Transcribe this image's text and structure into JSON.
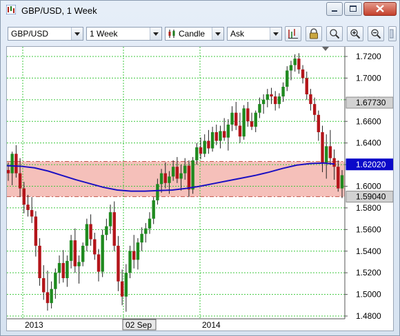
{
  "window": {
    "title": "GBP/USD,  1 Week",
    "minimize_glyph": "minimize-icon",
    "maximize_glyph": "maximize-icon",
    "close_glyph": "close-icon"
  },
  "toolbar": {
    "symbol": "GBP/USD",
    "timeframe": "1 Week",
    "chart_type": "Candle",
    "price_side": "Ask",
    "buttons": [
      "bar-chart-icon",
      "lock-icon",
      "zoom-fit-icon",
      "zoom-in-icon",
      "zoom-out-icon",
      "scroll-icon"
    ]
  },
  "chart_data": {
    "type": "candlestick",
    "symbol": "GBP/USD",
    "timeframe": "1 Week",
    "ylim": [
      1.47,
      1.728
    ],
    "y_ticks": [
      "1.7200",
      "1.7000",
      "1.6800",
      "1.6600",
      "1.6400",
      "1.6200",
      "1.6000",
      "1.5800",
      "1.5600",
      "1.5400",
      "1.5200",
      "1.5000",
      "1.4800"
    ],
    "x_labels": [
      "2013",
      "02 Sep",
      "2014"
    ],
    "price_labels": [
      {
        "value": "1.67730",
        "style": "gray"
      },
      {
        "value": "1.62020",
        "style": "blue"
      },
      {
        "value": "1.59040",
        "style": "gray"
      }
    ],
    "band": {
      "upper": 1.6229,
      "lower": 1.5904,
      "color": "#f4b9b3"
    },
    "moving_average": {
      "color": "#1b0fc2",
      "points": [
        [
          0,
          1.619
        ],
        [
          20,
          1.6185
        ],
        [
          40,
          1.617
        ],
        [
          60,
          1.614
        ],
        [
          80,
          1.61
        ],
        [
          100,
          1.606
        ],
        [
          120,
          1.6025
        ],
        [
          140,
          1.599
        ],
        [
          160,
          1.5965
        ],
        [
          180,
          1.5955
        ],
        [
          200,
          1.5955
        ],
        [
          220,
          1.596
        ],
        [
          240,
          1.5965
        ],
        [
          260,
          1.598
        ],
        [
          280,
          1.6
        ],
        [
          300,
          1.6025
        ],
        [
          320,
          1.605
        ],
        [
          340,
          1.6075
        ],
        [
          360,
          1.61
        ],
        [
          380,
          1.613
        ],
        [
          400,
          1.6165
        ],
        [
          420,
          1.6195
        ],
        [
          440,
          1.621
        ],
        [
          460,
          1.6215
        ],
        [
          475,
          1.6205
        ]
      ]
    },
    "candles": [
      [
        1.615,
        1.622,
        1.605,
        1.612
      ],
      [
        1.612,
        1.632,
        1.601,
        1.63
      ],
      [
        1.63,
        1.638,
        1.608,
        1.612
      ],
      [
        1.612,
        1.626,
        1.59,
        1.598
      ],
      [
        1.598,
        1.604,
        1.575,
        1.583
      ],
      [
        1.583,
        1.592,
        1.572,
        1.578
      ],
      [
        1.578,
        1.59,
        1.566,
        1.572
      ],
      [
        1.572,
        1.577,
        1.535,
        1.545
      ],
      [
        1.545,
        1.552,
        1.508,
        1.515
      ],
      [
        1.515,
        1.527,
        1.495,
        1.502
      ],
      [
        1.502,
        1.522,
        1.485,
        1.492
      ],
      [
        1.492,
        1.512,
        1.487,
        1.505
      ],
      [
        1.505,
        1.524,
        1.496,
        1.52
      ],
      [
        1.52,
        1.536,
        1.51,
        1.529
      ],
      [
        1.529,
        1.541,
        1.511,
        1.515
      ],
      [
        1.515,
        1.536,
        1.507,
        1.531
      ],
      [
        1.531,
        1.555,
        1.524,
        1.55
      ],
      [
        1.55,
        1.561,
        1.52,
        1.526
      ],
      [
        1.526,
        1.536,
        1.51,
        1.53
      ],
      [
        1.53,
        1.548,
        1.526,
        1.545
      ],
      [
        1.545,
        1.57,
        1.54,
        1.565
      ],
      [
        1.565,
        1.574,
        1.545,
        1.551
      ],
      [
        1.551,
        1.557,
        1.532,
        1.537
      ],
      [
        1.537,
        1.542,
        1.512,
        1.521
      ],
      [
        1.521,
        1.56,
        1.516,
        1.555
      ],
      [
        1.555,
        1.57,
        1.55,
        1.563
      ],
      [
        1.563,
        1.583,
        1.556,
        1.576
      ],
      [
        1.576,
        1.586,
        1.54,
        1.545
      ],
      [
        1.545,
        1.554,
        1.503,
        1.512
      ],
      [
        1.512,
        1.523,
        1.49,
        1.498
      ],
      [
        1.498,
        1.528,
        1.484,
        1.52
      ],
      [
        1.52,
        1.545,
        1.515,
        1.54
      ],
      [
        1.54,
        1.555,
        1.524,
        1.532
      ],
      [
        1.532,
        1.552,
        1.523,
        1.548
      ],
      [
        1.548,
        1.562,
        1.54,
        1.556
      ],
      [
        1.556,
        1.566,
        1.548,
        1.561
      ],
      [
        1.561,
        1.576,
        1.556,
        1.57
      ],
      [
        1.57,
        1.59,
        1.565,
        1.587
      ],
      [
        1.587,
        1.607,
        1.583,
        1.602
      ],
      [
        1.602,
        1.616,
        1.594,
        1.612
      ],
      [
        1.612,
        1.622,
        1.598,
        1.603
      ],
      [
        1.603,
        1.614,
        1.593,
        1.609
      ],
      [
        1.609,
        1.624,
        1.605,
        1.618
      ],
      [
        1.618,
        1.627,
        1.603,
        1.607
      ],
      [
        1.607,
        1.62,
        1.596,
        1.612
      ],
      [
        1.612,
        1.626,
        1.606,
        1.619
      ],
      [
        1.619,
        1.624,
        1.59,
        1.597
      ],
      [
        1.597,
        1.627,
        1.593,
        1.624
      ],
      [
        1.624,
        1.64,
        1.62,
        1.636
      ],
      [
        1.636,
        1.645,
        1.625,
        1.63
      ],
      [
        1.63,
        1.648,
        1.627,
        1.642
      ],
      [
        1.642,
        1.652,
        1.63,
        1.635
      ],
      [
        1.635,
        1.655,
        1.632,
        1.65
      ],
      [
        1.65,
        1.657,
        1.638,
        1.642
      ],
      [
        1.642,
        1.656,
        1.635,
        1.651
      ],
      [
        1.651,
        1.663,
        1.642,
        1.645
      ],
      [
        1.645,
        1.662,
        1.633,
        1.657
      ],
      [
        1.657,
        1.674,
        1.651,
        1.668
      ],
      [
        1.668,
        1.678,
        1.652,
        1.656
      ],
      [
        1.656,
        1.668,
        1.64,
        1.646
      ],
      [
        1.646,
        1.675,
        1.643,
        1.672
      ],
      [
        1.672,
        1.678,
        1.655,
        1.66
      ],
      [
        1.66,
        1.668,
        1.652,
        1.655
      ],
      [
        1.655,
        1.67,
        1.65,
        1.668
      ],
      [
        1.668,
        1.682,
        1.663,
        1.676
      ],
      [
        1.676,
        1.685,
        1.667,
        1.68
      ],
      [
        1.68,
        1.69,
        1.673,
        1.685
      ],
      [
        1.685,
        1.691,
        1.676,
        1.683
      ],
      [
        1.683,
        1.688,
        1.67,
        1.676
      ],
      [
        1.676,
        1.686,
        1.672,
        1.683
      ],
      [
        1.683,
        1.696,
        1.678,
        1.692
      ],
      [
        1.692,
        1.711,
        1.688,
        1.707
      ],
      [
        1.707,
        1.716,
        1.698,
        1.712
      ],
      [
        1.712,
        1.722,
        1.706,
        1.718
      ],
      [
        1.718,
        1.723,
        1.704,
        1.708
      ],
      [
        1.708,
        1.712,
        1.695,
        1.7
      ],
      [
        1.7,
        1.706,
        1.68,
        1.685
      ],
      [
        1.685,
        1.69,
        1.67,
        1.676
      ],
      [
        1.676,
        1.682,
        1.66,
        1.666
      ],
      [
        1.666,
        1.67,
        1.642,
        1.65
      ],
      [
        1.65,
        1.656,
        1.613,
        1.622
      ],
      [
        1.622,
        1.648,
        1.607,
        1.637
      ],
      [
        1.637,
        1.652,
        1.62,
        1.626
      ],
      [
        1.626,
        1.634,
        1.606,
        1.618
      ],
      [
        1.618,
        1.624,
        1.595,
        1.598
      ],
      [
        1.598,
        1.615,
        1.589,
        1.6102
      ]
    ]
  }
}
